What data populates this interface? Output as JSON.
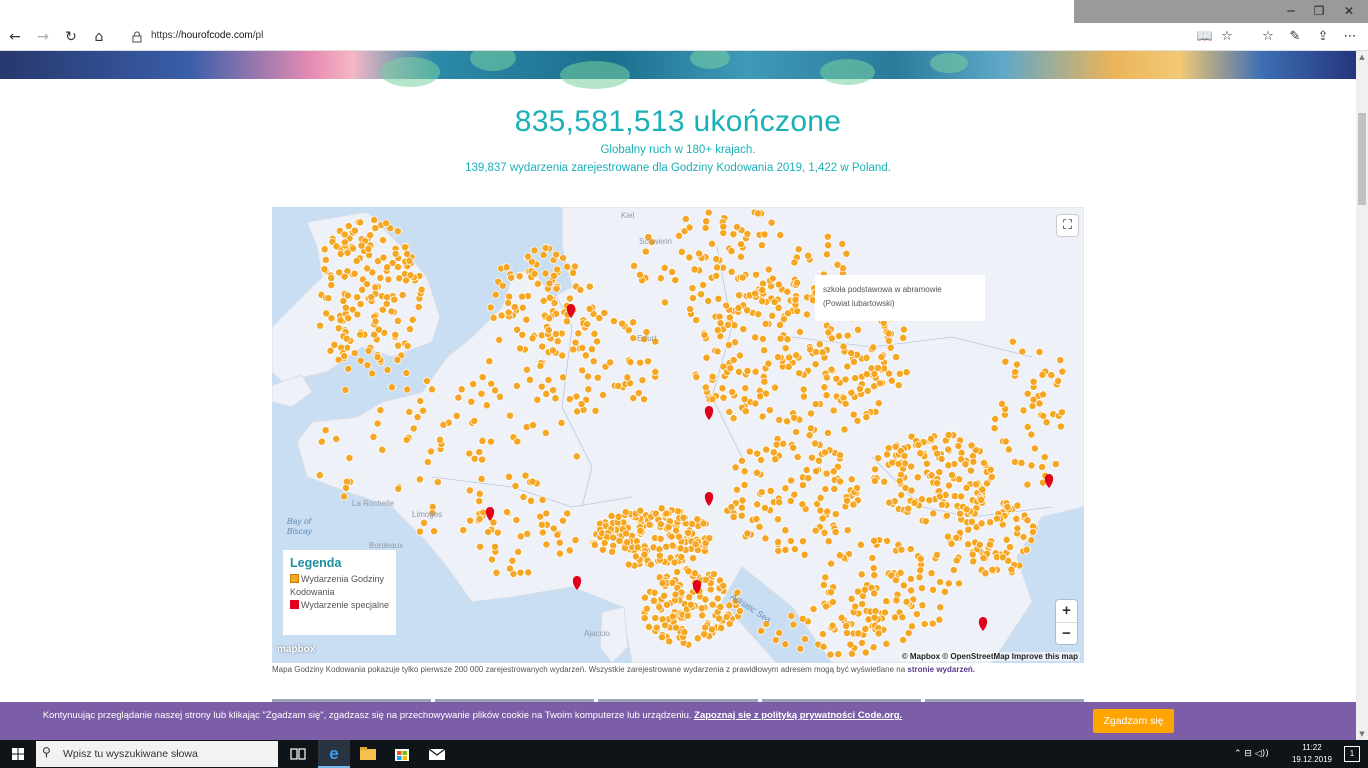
{
  "window": {
    "minimize_glyph": "─",
    "maximize_glyph": "❐",
    "close_glyph": "✕"
  },
  "browser": {
    "back_glyph": "←",
    "forward_glyph": "→",
    "refresh_glyph": "↻",
    "home_glyph": "⌂",
    "url_scheme": "https://",
    "url_host": "hourofcode.com",
    "url_path": "/pl",
    "reading_view_glyph": "📖",
    "favorite_glyph": "☆",
    "favorites_glyph": "☆",
    "notes_glyph": "✎",
    "share_glyph": "⇪",
    "more_glyph": "⋯"
  },
  "page": {
    "counter": "835,581,513 ukończone",
    "subline1": "Globalny ruch w 180+ krajach.",
    "subline2": "139,837 wydarzenia zarejestrowane dla Godziny Kodowania 2019, 1,422 w Poland."
  },
  "map": {
    "labels": {
      "kiel": "Kiel",
      "schwerin": "Schwerin",
      "erfurt": "Erfurt",
      "la_rochelle": "La Rochelle",
      "limoges": "Limoges",
      "bordeaux": "Bordeaux",
      "bay_of_biscay": "Bay of\nBiscay",
      "adriatic_sea": "Adriatic Sea",
      "ajaccio": "Ajaccio"
    },
    "popup_line1": "szkoła podstawowa w abramowie",
    "popup_line2": "(Powiat lubartowski)",
    "fullscreen_glyph": "⛶",
    "legend": {
      "title": "Legenda",
      "item1": "Wydarzenia Godziny Kodowania",
      "item2": "Wydarzenie specjalne",
      "color_events": "#f5a623",
      "color_special": "#e0001b"
    },
    "zoom_in": "+",
    "zoom_out": "−",
    "logo": "mapbox",
    "attribution": "© Mapbox © OpenStreetMap  Improve this map",
    "note": "Mapa Godziny Kodowania pokazuje tylko pierwsze 200 000 zarejestrowanych wydarzeń. Wszystkie zarejestrowane wydarzenia z prawidłowym adresem mogą być wyświetlane na",
    "note_link": "stronie wydarzeń."
  },
  "cookie": {
    "text": "Kontynuując przeglądanie naszej strony lub klikając \"Zgadzam się\", zgadzasz się na przechowywanie plików cookie na Twoim komputerze lub urządzeniu.",
    "link": "Zapoznaj się z polityką prywatności Code.org.",
    "button": "Zgadzam się"
  },
  "taskbar": {
    "search_placeholder": "Wpisz tu wyszukiwane słowa",
    "search_glyph": "⚲",
    "tray_icons": "⌃  ⊟  ◁))",
    "time": "11:22",
    "date": "19.12.2019",
    "notification_count": "1"
  }
}
